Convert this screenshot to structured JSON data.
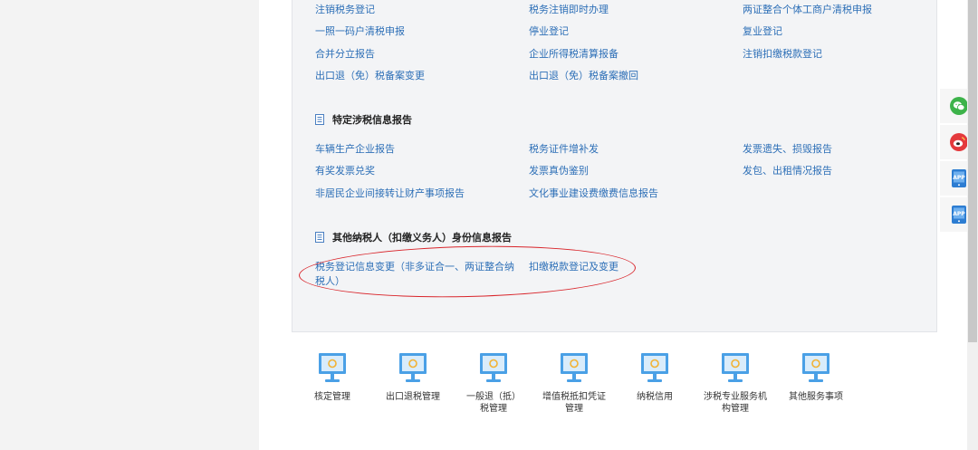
{
  "section_registration": {
    "links": [
      "注销税务登记",
      "税务注销即时办理",
      "两证整合个体工商户清税申报",
      "一照一码户清税申报",
      "停业登记",
      "复业登记",
      "合并分立报告",
      "企业所得税清算报备",
      "注销扣缴税款登记",
      "出口退（免）税备案变更",
      "出口退（免）税备案撤回"
    ]
  },
  "section_special": {
    "title": "特定涉税信息报告",
    "links": [
      "车辆生产企业报告",
      "税务证件增补发",
      "发票遗失、损毁报告",
      "有奖发票兑奖",
      "发票真伪鉴别",
      "发包、出租情况报告",
      "非居民企业间接转让财产事项报告",
      "文化事业建设费缴费信息报告"
    ]
  },
  "section_other": {
    "title": "其他纳税人（扣缴义务人）身份信息报告",
    "links": [
      "税务登记信息变更（非多证合一、两证整合纳税人）",
      "扣缴税款登记及变更"
    ]
  },
  "tiles": [
    {
      "label": "核定管理"
    },
    {
      "label": "出口退税管理"
    },
    {
      "label": "一般退（抵）税管理"
    },
    {
      "label": "增值税抵扣凭证管理"
    },
    {
      "label": "纳税信用"
    },
    {
      "label": "涉税专业服务机构管理"
    },
    {
      "label": "其他服务事项"
    }
  ],
  "side_buttons": [
    {
      "icon": "wechat-icon",
      "color": "#3db34a"
    },
    {
      "icon": "weibo-icon",
      "color": "#e4393c"
    },
    {
      "icon": "app-download-icon",
      "color": "#2d7dd2",
      "text": "APP"
    },
    {
      "icon": "app-download-icon",
      "color": "#2d7dd2",
      "text": "APP"
    }
  ],
  "colors": {
    "link": "#2d6fb7",
    "annotation": "#d9252b",
    "tile_icon": "#4aa0e6"
  }
}
